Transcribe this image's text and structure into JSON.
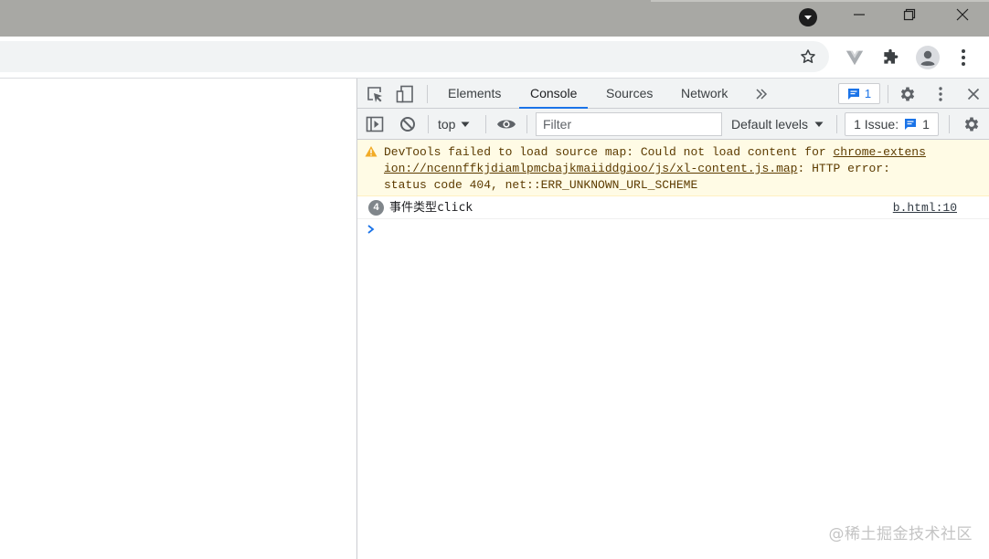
{
  "window": {
    "controls": [
      "minimize-icon",
      "restore-icon",
      "close-icon"
    ],
    "profile_icon": "chevron-down-icon"
  },
  "toolbar": {
    "icons": [
      "star-icon",
      "vue-devtools-icon",
      "extensions-icon",
      "profile-avatar-icon",
      "more-menu-icon"
    ]
  },
  "devtools": {
    "tabs": [
      {
        "label": "Elements"
      },
      {
        "label": "Console",
        "active": true
      },
      {
        "label": "Sources"
      },
      {
        "label": "Network"
      }
    ],
    "messages_count": "1",
    "console_bar": {
      "context": "top",
      "filter_placeholder": "Filter",
      "levels": "Default levels",
      "issues_label": "1 Issue:",
      "issues_count": "1"
    },
    "console": {
      "warning": {
        "line1_pre": "DevTools failed to load source map: Could not load content for ",
        "line1_link": "chrome-extens",
        "line2_link": "ion://ncennffkjdiamlpmcbajkmaiiddgioo/js/xl-content.js.map",
        "line2_post": ": HTTP error:",
        "line3": "status code 404, net::ERR_UNKNOWN_URL_SCHEME"
      },
      "log": {
        "count": "4",
        "message": "事件类型click",
        "source": "b.html:10"
      }
    }
  },
  "watermark": "@稀土掘金技术社区",
  "colors": {
    "accent": "#1a73e8",
    "warning_bg": "#fffbe5",
    "warning_text": "#5c3b00",
    "warning_icon": "#f2ab26"
  }
}
